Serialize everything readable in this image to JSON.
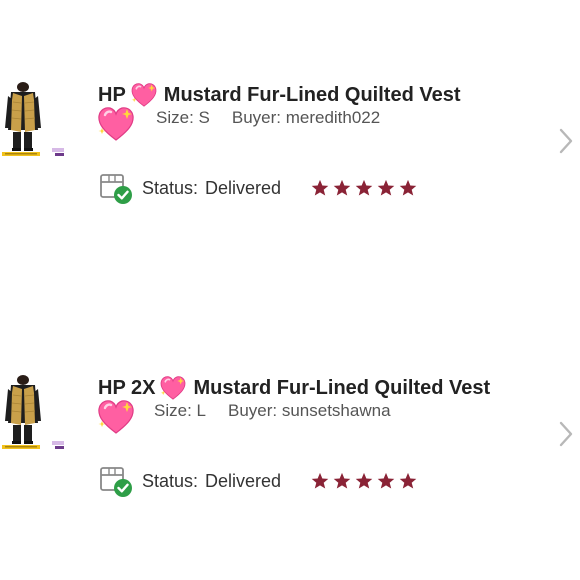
{
  "orders": [
    {
      "title_prefix": "HP",
      "title": "Mustard Fur-Lined Quilted Vest",
      "heart_icon": "sparkling-heart-icon",
      "size": "Size: S",
      "buyer": "Buyer: meredith022",
      "status_label": "Status:",
      "status_value": "Delivered",
      "rating": 5
    },
    {
      "title_prefix": "HP 2X",
      "title": "Mustard Fur-Lined Quilted Vest",
      "heart_icon": "sparkling-heart-icon",
      "size": "Size: L",
      "buyer": "Buyer: sunsetshawna",
      "status_label": "Status:",
      "status_value": "Delivered",
      "rating": 5
    }
  ],
  "colors": {
    "star": "#8a2336",
    "check": "#2e9e47",
    "chevron": "#b8b8b8",
    "heart": "#ff5fa2",
    "vest": "#c9a04a"
  }
}
